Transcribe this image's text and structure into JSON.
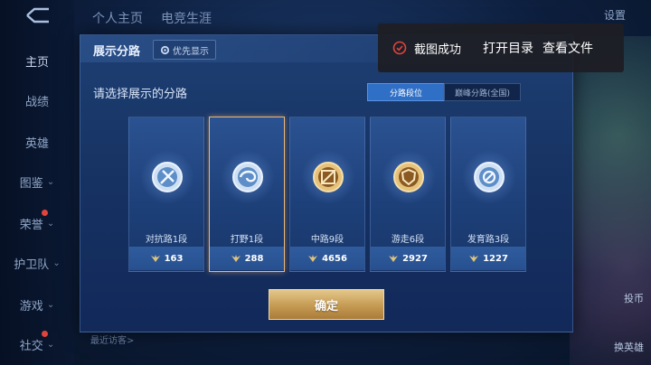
{
  "nav": {
    "items": [
      {
        "label": "主页",
        "chevron": false,
        "active": true
      },
      {
        "label": "战绩",
        "chevron": false
      },
      {
        "label": "英雄",
        "chevron": false
      },
      {
        "label": "图鉴",
        "chevron": true
      },
      {
        "label": "荣誉",
        "chevron": true
      },
      {
        "label": "护卫队",
        "chevron": true
      },
      {
        "label": "游戏",
        "chevron": true
      },
      {
        "label": "社交",
        "chevron": true
      }
    ]
  },
  "topbar": {
    "tabs": [
      "个人主页",
      "电竞生涯"
    ],
    "settings_label": "设置"
  },
  "right_panel": {
    "links": [
      "投币",
      "换英雄"
    ]
  },
  "bottom": {
    "visitors_label": "最近访客>"
  },
  "dialog": {
    "title": "展示分路",
    "priority_label": "优先显示",
    "prompt": "请选择展示的分路",
    "segments": [
      "分路段位",
      "巅峰分路(全国)"
    ],
    "cards": [
      {
        "name": "对抗路1段",
        "score": "163",
        "emblem": "silver-sword",
        "selected": false
      },
      {
        "name": "打野1段",
        "score": "288",
        "emblem": "silver-swirl",
        "selected": true
      },
      {
        "name": "中路9段",
        "score": "4656",
        "emblem": "gold-staff",
        "selected": false
      },
      {
        "name": "游走6段",
        "score": "2927",
        "emblem": "gold-shield",
        "selected": false
      },
      {
        "name": "发育路3段",
        "score": "1227",
        "emblem": "silver-target",
        "selected": false
      }
    ],
    "confirm_label": "确定"
  },
  "toast": {
    "message": "截图成功",
    "action_open_dir": "打开目录",
    "action_view_file": "查看文件"
  },
  "colors": {
    "accent_blue": "#2f6fc6",
    "gold": "#c59a52",
    "selected_border": "#e9b77c",
    "toast_icon": "#e0443d"
  }
}
